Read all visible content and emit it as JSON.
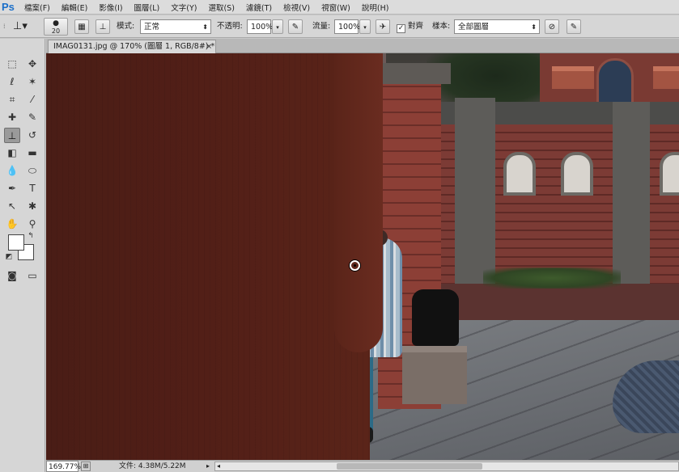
{
  "app": {
    "logo": "Ps"
  },
  "menu": [
    "檔案(F)",
    "編輯(E)",
    "影像(I)",
    "圖層(L)",
    "文字(Y)",
    "選取(S)",
    "濾鏡(T)",
    "檢視(V)",
    "視窗(W)",
    "說明(H)"
  ],
  "options": {
    "brush_size": "20",
    "mode_label": "模式:",
    "mode_value": "正常",
    "opacity_label": "不透明:",
    "opacity_value": "100%",
    "flow_label": "流量:",
    "flow_value": "100%",
    "aligned_label": "對齊",
    "aligned_checked": "✓",
    "sample_label": "樣本:",
    "sample_value": "全部圖層"
  },
  "document": {
    "tab_title": "IMAG0131.jpg @ 170% (圖層 1, RGB/8#) *",
    "tab_close": "×"
  },
  "status": {
    "zoom": "169.77%",
    "doc_info": "文件: 4.38M/5.22M"
  },
  "colors": {
    "foreground": "#ffffff",
    "background": "#ffffff",
    "accent": "#1b6fc9"
  }
}
